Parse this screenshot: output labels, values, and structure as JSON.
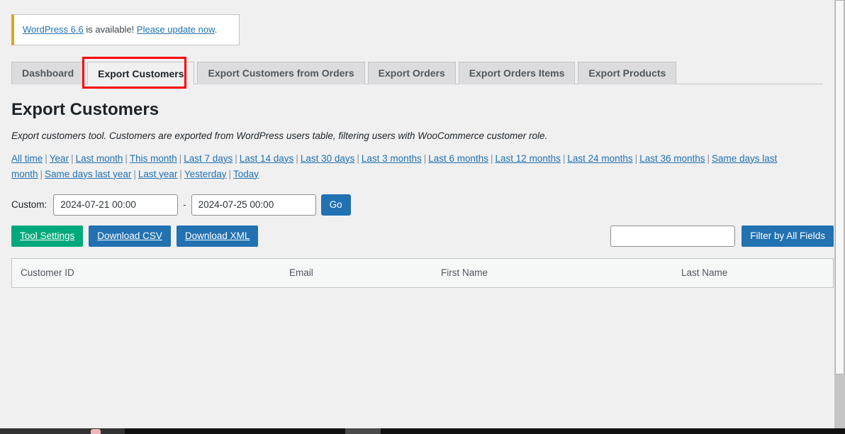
{
  "notice": {
    "link_version": "WordPress 6.6",
    "text_middle": " is available! ",
    "link_update": "Please update now",
    "text_end": "."
  },
  "tabs": [
    {
      "label": "Dashboard",
      "active": false
    },
    {
      "label": "Export Customers",
      "active": true
    },
    {
      "label": "Export Customers from Orders",
      "active": false
    },
    {
      "label": "Export Orders",
      "active": false
    },
    {
      "label": "Export Orders Items",
      "active": false
    },
    {
      "label": "Export Products",
      "active": false
    }
  ],
  "page": {
    "title": "Export Customers",
    "description": "Export customers tool. Customers are exported from WordPress users table, filtering users with WooCommerce customer role."
  },
  "range_links": [
    "All time",
    "Year",
    "Last month",
    "This month",
    "Last 7 days",
    "Last 14 days",
    "Last 30 days",
    "Last 3 months",
    "Last 6 months",
    "Last 12 months",
    "Last 24 months",
    "Last 36 months",
    "Same days last month",
    "Same days last year",
    "Last year",
    "Yesterday",
    "Today"
  ],
  "custom_range": {
    "label": "Custom:",
    "date_from_value": "2024-07-21 00:00",
    "date_from_placeholder": "From date",
    "separator": "-",
    "date_to_value": "2024-07-25 00:00",
    "date_to_placeholder": "To date",
    "go_label": "Go"
  },
  "actions": {
    "tool_settings_label": "Tool Settings",
    "download_csv_label": "Download CSV",
    "download_xml_label": "Download XML",
    "filter_input_value": "",
    "filter_input_placeholder": "",
    "filter_button_label": "Filter by All Fields"
  },
  "table": {
    "columns": [
      "Customer ID",
      "Email",
      "First Name",
      "Last Name"
    ],
    "rows": []
  },
  "colors": {
    "accent_blue": "#2271b1",
    "accent_green": "#00a97a",
    "notice_border": "#dba617",
    "annotation_red": "#ff0000",
    "page_background": "#f0f0f1"
  }
}
